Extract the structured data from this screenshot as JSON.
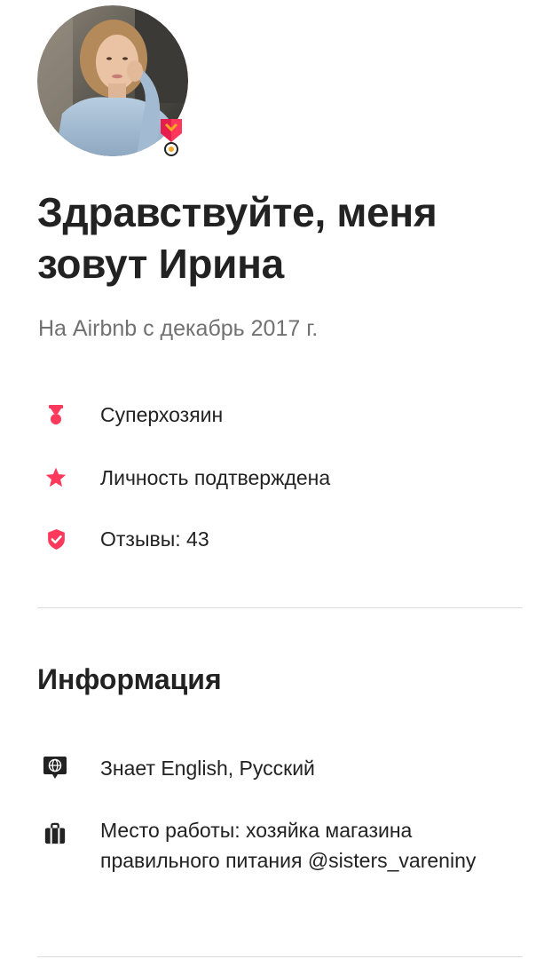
{
  "profile": {
    "greeting": "Здравствуйте, меня зовут Ирина",
    "member_since": "На Airbnb с декабрь 2017 г."
  },
  "stats": [
    {
      "icon": "superhost-ribbon-icon",
      "label": "Суперхозяин"
    },
    {
      "icon": "star-icon",
      "label": "Личность подтверждена"
    },
    {
      "icon": "shield-check-icon",
      "label": "Отзывы: 43"
    }
  ],
  "info": {
    "title": "Информация",
    "languages": "Знает English, Русский",
    "work": "Место работы: хозяйка магазина правильного питания @sisters_vareniny"
  },
  "colors": {
    "brand": "#FF385C",
    "text": "#222222",
    "muted": "#717171",
    "divider": "#DDDDDD"
  }
}
